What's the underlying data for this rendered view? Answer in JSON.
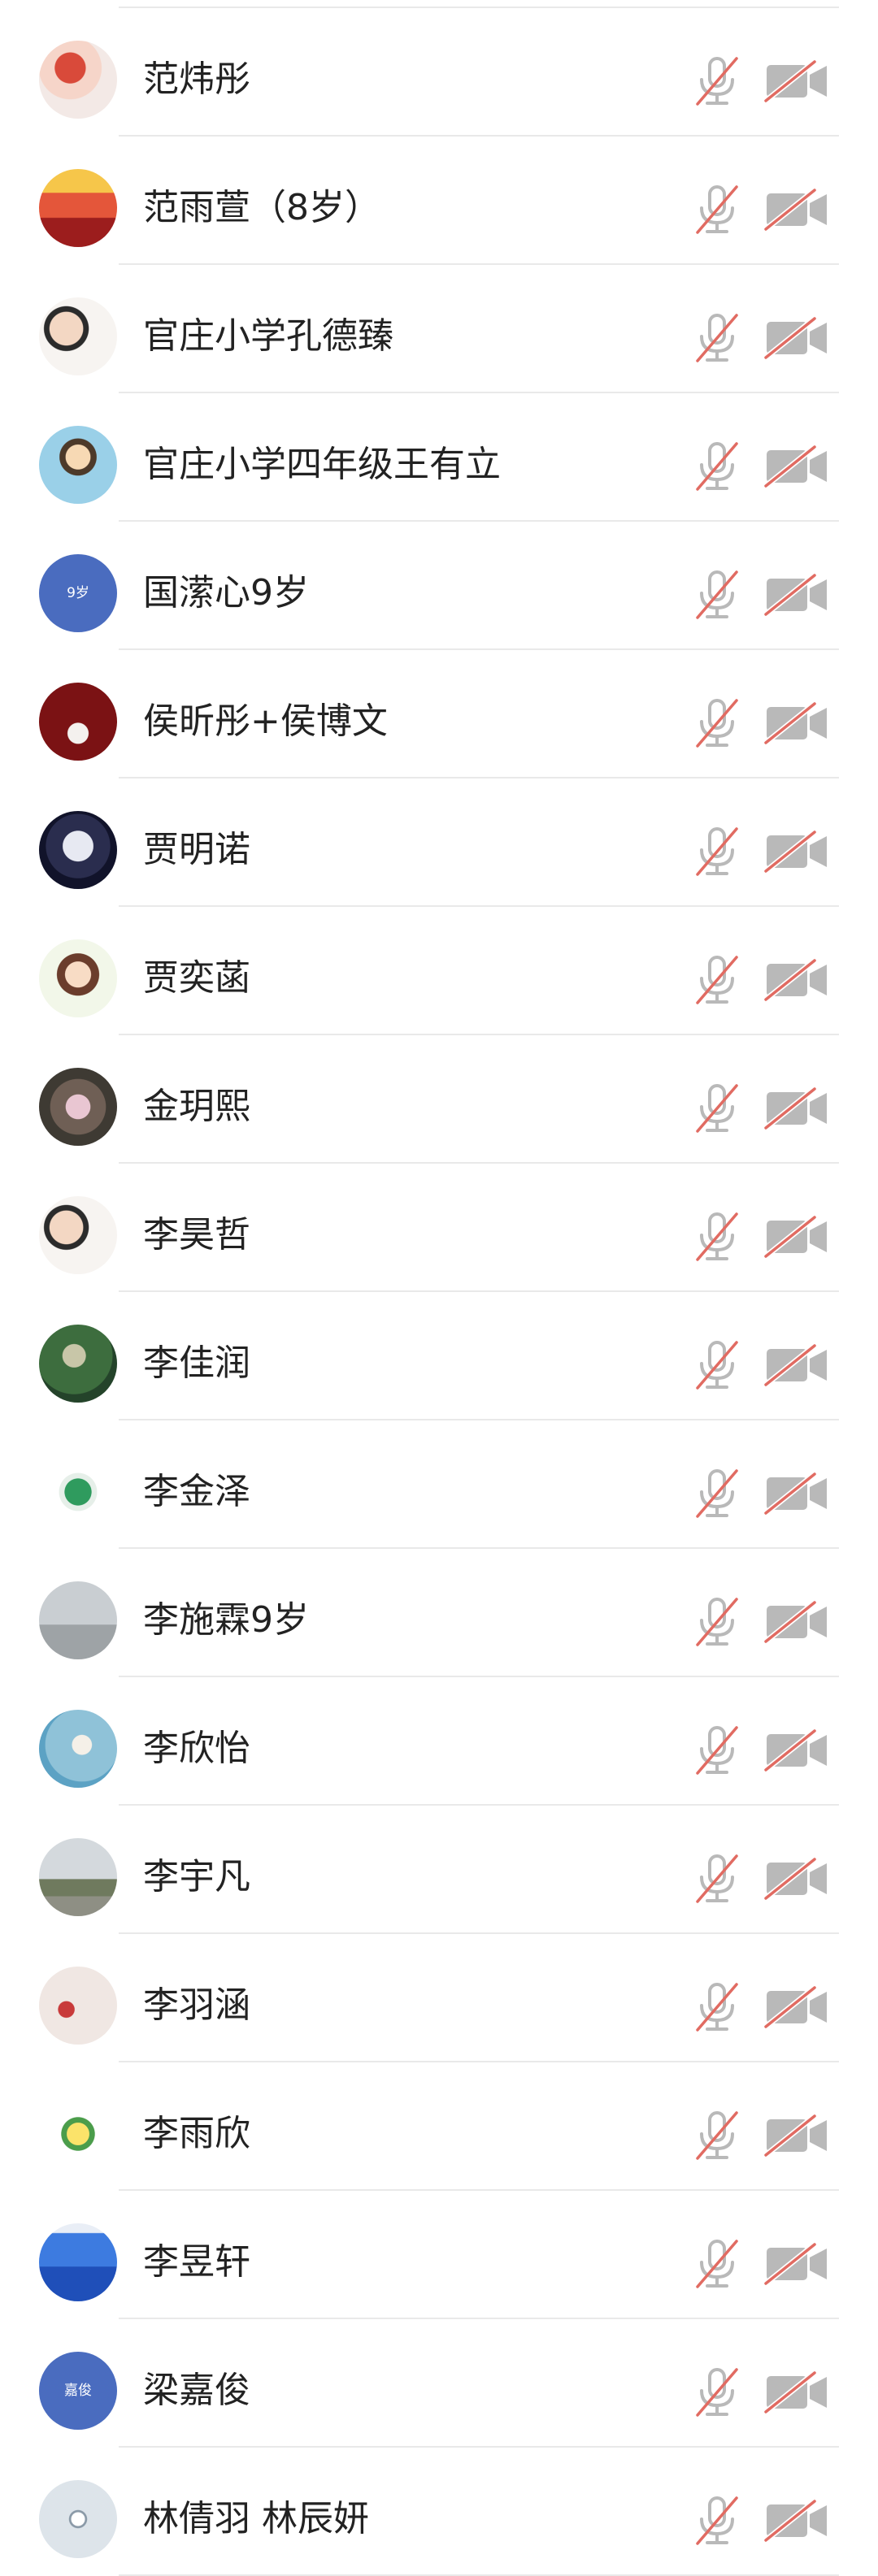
{
  "colors": {
    "name_text": "#222222",
    "icon_gray": "#b9b9b9",
    "mute_slash": "#e16b62",
    "divider": "#e9e9e9"
  },
  "participants": [
    {
      "name": "范炜彤",
      "avatar_style": "cartoon-mermaid",
      "mic": "mic-muted-icon",
      "camera": "camera-off-icon"
    },
    {
      "name": "范雨萱（8岁）",
      "avatar_style": "red-banner-photo",
      "mic": "mic-muted-icon",
      "camera": "camera-off-icon"
    },
    {
      "name": "官庄小学孔德臻",
      "avatar_style": "portrait-photo",
      "mic": "mic-muted-icon",
      "camera": "camera-off-icon"
    },
    {
      "name": "官庄小学四年级王有立",
      "avatar_style": "cartoon-girl",
      "mic": "mic-muted-icon",
      "camera": "camera-off-icon"
    },
    {
      "name": "国潆心9岁",
      "avatar_style": "text-avatar",
      "avatar_text": "9岁",
      "avatar_color": "#4a6cbf",
      "mic": "mic-muted-icon",
      "camera": "camera-off-icon"
    },
    {
      "name": "侯昕彤+侯博文",
      "avatar_style": "dark-red-rabbits",
      "mic": "mic-muted-icon",
      "camera": "camera-off-icon"
    },
    {
      "name": "贾明诺",
      "avatar_style": "anime-masked",
      "mic": "mic-muted-icon",
      "camera": "camera-off-icon"
    },
    {
      "name": "贾奕菡",
      "avatar_style": "cartoon-princess",
      "mic": "mic-muted-icon",
      "camera": "camera-off-icon"
    },
    {
      "name": "金玥熙",
      "avatar_style": "blossom-photo",
      "mic": "mic-muted-icon",
      "camera": "camera-off-icon"
    },
    {
      "name": "李昊哲",
      "avatar_style": "portrait-photo",
      "mic": "mic-muted-icon",
      "camera": "camera-off-icon"
    },
    {
      "name": "李佳润",
      "avatar_style": "garden-photo",
      "mic": "mic-muted-icon",
      "camera": "camera-off-icon"
    },
    {
      "name": "李金泽",
      "avatar_style": "emerald-gem",
      "mic": "mic-muted-icon",
      "camera": "camera-off-icon"
    },
    {
      "name": "李施霖9岁",
      "avatar_style": "gray-outdoor-photo",
      "mic": "mic-muted-icon",
      "camera": "camera-off-icon"
    },
    {
      "name": "李欣怡",
      "avatar_style": "blue-sky-photo",
      "mic": "mic-muted-icon",
      "camera": "camera-off-icon"
    },
    {
      "name": "李宇凡",
      "avatar_style": "landscape-photo",
      "mic": "mic-muted-icon",
      "camera": "camera-off-icon"
    },
    {
      "name": "李羽涵",
      "avatar_style": "heart-photo",
      "mic": "mic-muted-icon",
      "camera": "camera-off-icon"
    },
    {
      "name": "李雨欣",
      "avatar_style": "cartoon-sticker",
      "mic": "mic-muted-icon",
      "camera": "camera-off-icon"
    },
    {
      "name": "李昱轩",
      "avatar_style": "blue-gradient",
      "mic": "mic-muted-icon",
      "camera": "camera-off-icon"
    },
    {
      "name": "梁嘉俊",
      "avatar_style": "text-avatar",
      "avatar_text": "嘉俊",
      "avatar_color": "#4a6cbf",
      "mic": "mic-muted-icon",
      "camera": "camera-off-icon"
    },
    {
      "name": "林倩羽 林辰妍",
      "avatar_style": "ferris-wheel-photo",
      "mic": "mic-muted-icon",
      "camera": "camera-off-icon"
    }
  ]
}
